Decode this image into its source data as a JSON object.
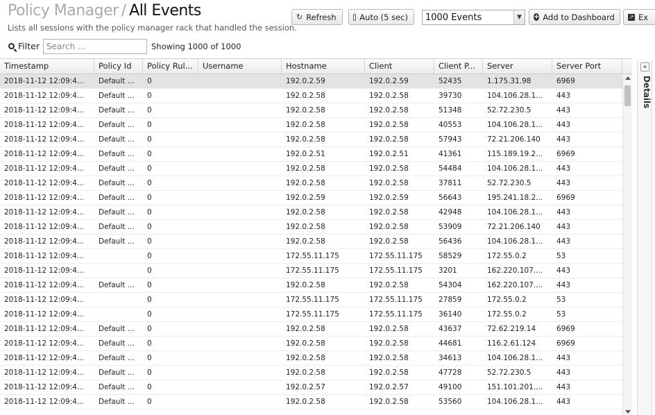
{
  "header": {
    "breadcrumb": "Policy Manager",
    "separator": "/",
    "title": "All Events",
    "subtitle": "Lists all sessions with the policy manager rack that handled the session."
  },
  "toolbar": {
    "refresh_label": "Refresh",
    "auto_label": "Auto (5 sec)",
    "events_select": "1000 Events",
    "add_dashboard_label": "Add to Dashboard",
    "export_label": "Ex"
  },
  "filter": {
    "label": "Filter",
    "placeholder": "Search ...",
    "showing": "Showing 1000 of 1000"
  },
  "columns": [
    "Timestamp",
    "Policy Id",
    "Policy Rul...",
    "Username",
    "Hostname",
    "Client",
    "Client P...",
    "Server",
    "Server Port"
  ],
  "rows": [
    [
      "2018-11-12 12:09:4...",
      "Default ...",
      "0",
      "",
      "192.0.2.59",
      "192.0.2.59",
      "52435",
      "1.175.31.98",
      "6969"
    ],
    [
      "2018-11-12 12:09:4...",
      "Default ...",
      "0",
      "",
      "192.0.2.58",
      "192.0.2.58",
      "39730",
      "104.106.28.1...",
      "443"
    ],
    [
      "2018-11-12 12:09:4...",
      "Default ...",
      "0",
      "",
      "192.0.2.58",
      "192.0.2.58",
      "51348",
      "52.72.230.5",
      "443"
    ],
    [
      "2018-11-12 12:09:4...",
      "Default ...",
      "0",
      "",
      "192.0.2.58",
      "192.0.2.58",
      "40553",
      "104.106.28.1...",
      "443"
    ],
    [
      "2018-11-12 12:09:4...",
      "Default ...",
      "0",
      "",
      "192.0.2.58",
      "192.0.2.58",
      "57943",
      "72.21.206.140",
      "443"
    ],
    [
      "2018-11-12 12:09:4...",
      "Default ...",
      "0",
      "",
      "192.0.2.51",
      "192.0.2.51",
      "41361",
      "115.189.19.2...",
      "6969"
    ],
    [
      "2018-11-12 12:09:4...",
      "Default ...",
      "0",
      "",
      "192.0.2.58",
      "192.0.2.58",
      "54484",
      "104.106.28.1...",
      "443"
    ],
    [
      "2018-11-12 12:09:4...",
      "Default ...",
      "0",
      "",
      "192.0.2.58",
      "192.0.2.58",
      "37811",
      "52.72.230.5",
      "443"
    ],
    [
      "2018-11-12 12:09:4...",
      "Default ...",
      "0",
      "",
      "192.0.2.59",
      "192.0.2.59",
      "56643",
      "195.241.18.2...",
      "6969"
    ],
    [
      "2018-11-12 12:09:4...",
      "Default ...",
      "0",
      "",
      "192.0.2.58",
      "192.0.2.58",
      "42948",
      "104.106.28.1...",
      "443"
    ],
    [
      "2018-11-12 12:09:4...",
      "Default ...",
      "0",
      "",
      "192.0.2.58",
      "192.0.2.58",
      "53909",
      "72.21.206.140",
      "443"
    ],
    [
      "2018-11-12 12:09:4...",
      "Default ...",
      "0",
      "",
      "192.0.2.58",
      "192.0.2.58",
      "56436",
      "104.106.28.1...",
      "443"
    ],
    [
      "2018-11-12 12:09:4...",
      "",
      "0",
      "",
      "172.55.11.175",
      "172.55.11.175",
      "58529",
      "172.55.0.2",
      "53"
    ],
    [
      "2018-11-12 12:09:4...",
      "",
      "0",
      "",
      "172.55.11.175",
      "172.55.11.175",
      "3201",
      "162.220.107....",
      "443"
    ],
    [
      "2018-11-12 12:09:4...",
      "Default ...",
      "0",
      "",
      "192.0.2.58",
      "192.0.2.58",
      "54304",
      "162.220.107....",
      "443"
    ],
    [
      "2018-11-12 12:09:4...",
      "",
      "0",
      "",
      "172.55.11.175",
      "172.55.11.175",
      "27859",
      "172.55.0.2",
      "53"
    ],
    [
      "2018-11-12 12:09:4...",
      "",
      "0",
      "",
      "172.55.11.175",
      "172.55.11.175",
      "36140",
      "172.55.0.2",
      "53"
    ],
    [
      "2018-11-12 12:09:4...",
      "Default ...",
      "0",
      "",
      "192.0.2.58",
      "192.0.2.58",
      "43637",
      "72.62.219.14",
      "6969"
    ],
    [
      "2018-11-12 12:09:4...",
      "Default ...",
      "0",
      "",
      "192.0.2.58",
      "192.0.2.58",
      "44681",
      "116.2.61.124",
      "6969"
    ],
    [
      "2018-11-12 12:09:4...",
      "Default ...",
      "0",
      "",
      "192.0.2.58",
      "192.0.2.58",
      "34613",
      "104.106.28.1...",
      "443"
    ],
    [
      "2018-11-12 12:09:4...",
      "Default ...",
      "0",
      "",
      "192.0.2.58",
      "192.0.2.58",
      "47728",
      "52.72.230.5",
      "443"
    ],
    [
      "2018-11-12 12:09:4...",
      "Default ...",
      "0",
      "",
      "192.0.2.57",
      "192.0.2.57",
      "49100",
      "151.101.201....",
      "443"
    ],
    [
      "2018-11-12 12:09:4...",
      "Default ...",
      "0",
      "",
      "192.0.2.58",
      "192.0.2.58",
      "53560",
      "104.106.28.1...",
      "443"
    ]
  ],
  "selected_row": 0,
  "details": {
    "label": "Details",
    "collapse_icon": "double-chevron-left-icon"
  }
}
